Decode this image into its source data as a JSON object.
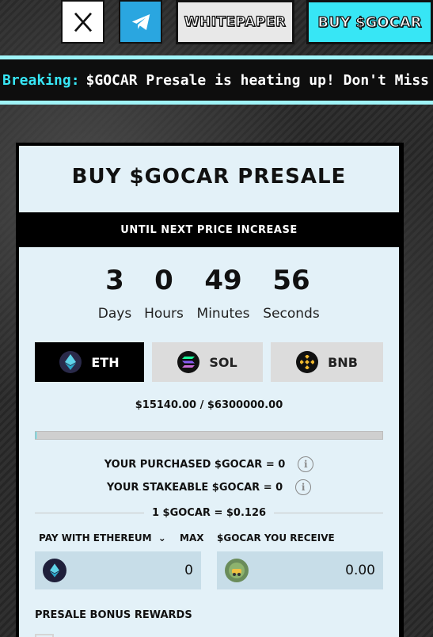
{
  "header": {
    "whitepaper_label": "WHITEPAPER",
    "buy_label": "BUY $GOCAR",
    "x_icon": "x-logo-icon",
    "telegram_icon": "telegram-icon"
  },
  "ticker": {
    "label": "Breaking:",
    "message": "$GOCAR Presale is heating up! Don't Miss the Be"
  },
  "presale": {
    "title": "BUY $GOCAR PRESALE",
    "countdown_banner": "UNTIL NEXT PRICE INCREASE",
    "countdown": [
      {
        "value": "3",
        "label": "Days"
      },
      {
        "value": "0",
        "label": "Hours"
      },
      {
        "value": "49",
        "label": "Minutes"
      },
      {
        "value": "56",
        "label": "Seconds"
      }
    ],
    "tabs": [
      {
        "label": "ETH",
        "icon": "ethereum-icon",
        "active": true
      },
      {
        "label": "SOL",
        "icon": "solana-icon",
        "active": false
      },
      {
        "label": "BNB",
        "icon": "bnb-icon",
        "active": false
      }
    ],
    "raised": "$15140.00 / $6300000.00",
    "progress_fraction": 0.0024,
    "purchased": "YOUR PURCHASED $GOCAR = 0",
    "stakeable": "YOUR STAKEABLE $GOCAR = 0",
    "rate": "1 $GOCAR = $0.126",
    "pay_label": "PAY WITH ETHEREUM",
    "max_label": "MAX",
    "pay_value": "0",
    "receive_label": "$GOCAR YOU RECEIVE",
    "receive_value": "0.00",
    "bonus_label": "PRESALE BONUS REWARDS"
  },
  "colors": {
    "accent": "#37e6f5",
    "card_bg": "#e3f1f8",
    "input_bg": "#c7dde8"
  }
}
